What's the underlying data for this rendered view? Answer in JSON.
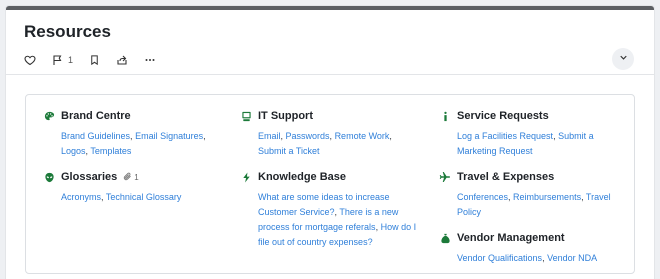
{
  "page": {
    "title": "Resources"
  },
  "toolbar": {
    "like_icon": "heart-icon",
    "flag_icon": "flag-icon",
    "flag_count": "1",
    "bookmark_icon": "bookmark-icon",
    "share_icon": "share-icon",
    "more_icon": "more-horizontal-icon",
    "collapse_icon": "chevron-down-icon"
  },
  "colors": {
    "accent_green": "#1c7a3a",
    "link_blue": "#2f7fd9",
    "top_bar": "#5c5f63"
  },
  "categories": [
    {
      "title": "Brand Centre",
      "icon": "palette-icon",
      "links": [
        "Brand Guidelines",
        "Email Signatures",
        "Logos",
        "Templates"
      ]
    },
    {
      "title": "IT Support",
      "icon": "computer-icon",
      "links": [
        "Email",
        "Passwords",
        "Remote Work",
        "Submit a Ticket"
      ]
    },
    {
      "title": "Service Requests",
      "icon": "info-icon",
      "links": [
        "Log a Facilities Request",
        "Submit a Marketing Request"
      ]
    },
    {
      "title": "Glossaries",
      "icon": "alien-icon",
      "attachment_count": "1",
      "links": [
        "Acronyms",
        "Technical Glossary"
      ]
    },
    {
      "title": "Knowledge Base",
      "icon": "lightning-icon",
      "links": [
        "What are some ideas to increase Customer Service?",
        "There is a new process for mortgage referals",
        "How do I file out of country expenses?"
      ]
    },
    {
      "title": "Travel & Expenses",
      "icon": "airplane-icon",
      "links": [
        "Conferences",
        "Reimbursements",
        "Travel Policy"
      ]
    },
    {
      "title": "Vendor Management",
      "icon": "money-bag-icon",
      "links": [
        "Vendor Qualifications",
        "Vendor NDA"
      ]
    }
  ]
}
